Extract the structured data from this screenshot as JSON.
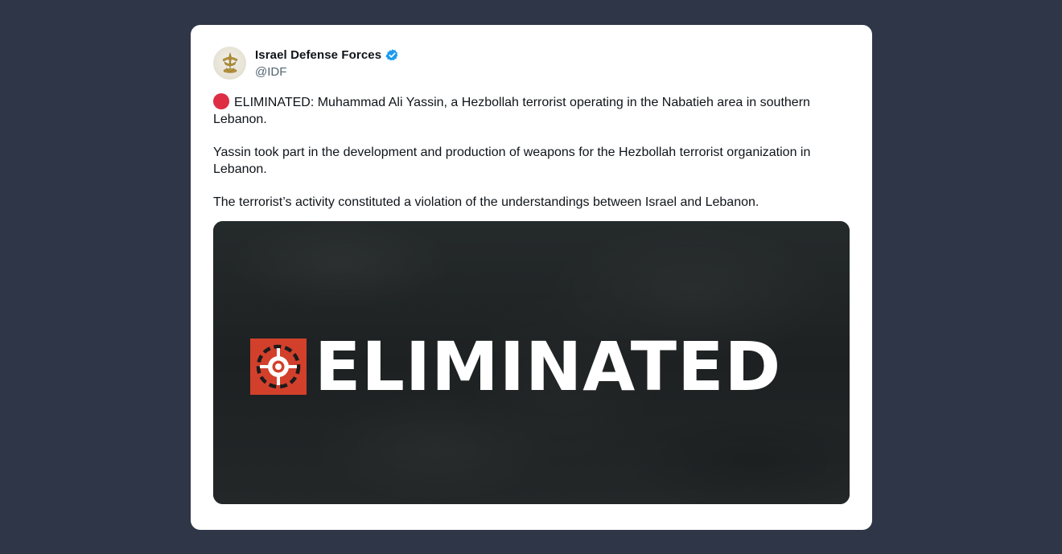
{
  "author": {
    "name": "Israel Defense Forces",
    "handle": "@IDF",
    "verified": true,
    "verified_color": "#1d9bf0"
  },
  "tweet": {
    "lead_emoji": "red-circle-icon",
    "paragraphs": [
      "ELIMINATED: Muhammad Ali Yassin, a Hezbollah terrorist operating in the Nabatieh area in southern Lebanon.",
      "Yassin took part in the development and production of weapons for the Hezbollah terrorist organization in Lebanon.",
      "The terrorist’s activity constituted a violation of the understandings between Israel and Lebanon."
    ]
  },
  "media": {
    "headline": "ELIMINATED",
    "icon": "crosshair-icon",
    "accent_color": "#d2402c",
    "background_color": "#1f2324"
  },
  "colors": {
    "page_background": "#2f3647",
    "card_background": "#ffffff",
    "text_primary": "#0f1419",
    "text_secondary": "#536471",
    "red_circle": "#dd2e44"
  }
}
